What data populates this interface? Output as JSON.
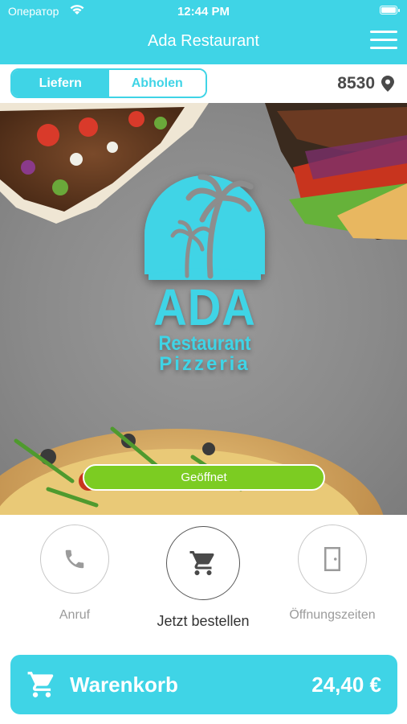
{
  "status_bar": {
    "carrier": "Оператор",
    "time": "12:44 PM"
  },
  "header": {
    "title": "Ada Restaurant"
  },
  "order_mode": {
    "delivery": "Liefern",
    "pickup": "Abholen",
    "selected": "Liefern"
  },
  "location": {
    "postcode": "8530"
  },
  "logo": {
    "line1": "ADA",
    "line2": "Restaurant",
    "line3": "Pizzeria"
  },
  "open_status": "Geöffnet",
  "actions": [
    {
      "label": "Anruf",
      "icon": "phone-icon"
    },
    {
      "label": "Jetzt bestellen",
      "icon": "cart-icon"
    },
    {
      "label": "Öffnungszeiten",
      "icon": "door-icon"
    }
  ],
  "cart": {
    "label": "Warenkorb",
    "total": "24,40 €"
  },
  "colors": {
    "accent": "#3fd4e6",
    "open_green": "#7ccc22"
  }
}
